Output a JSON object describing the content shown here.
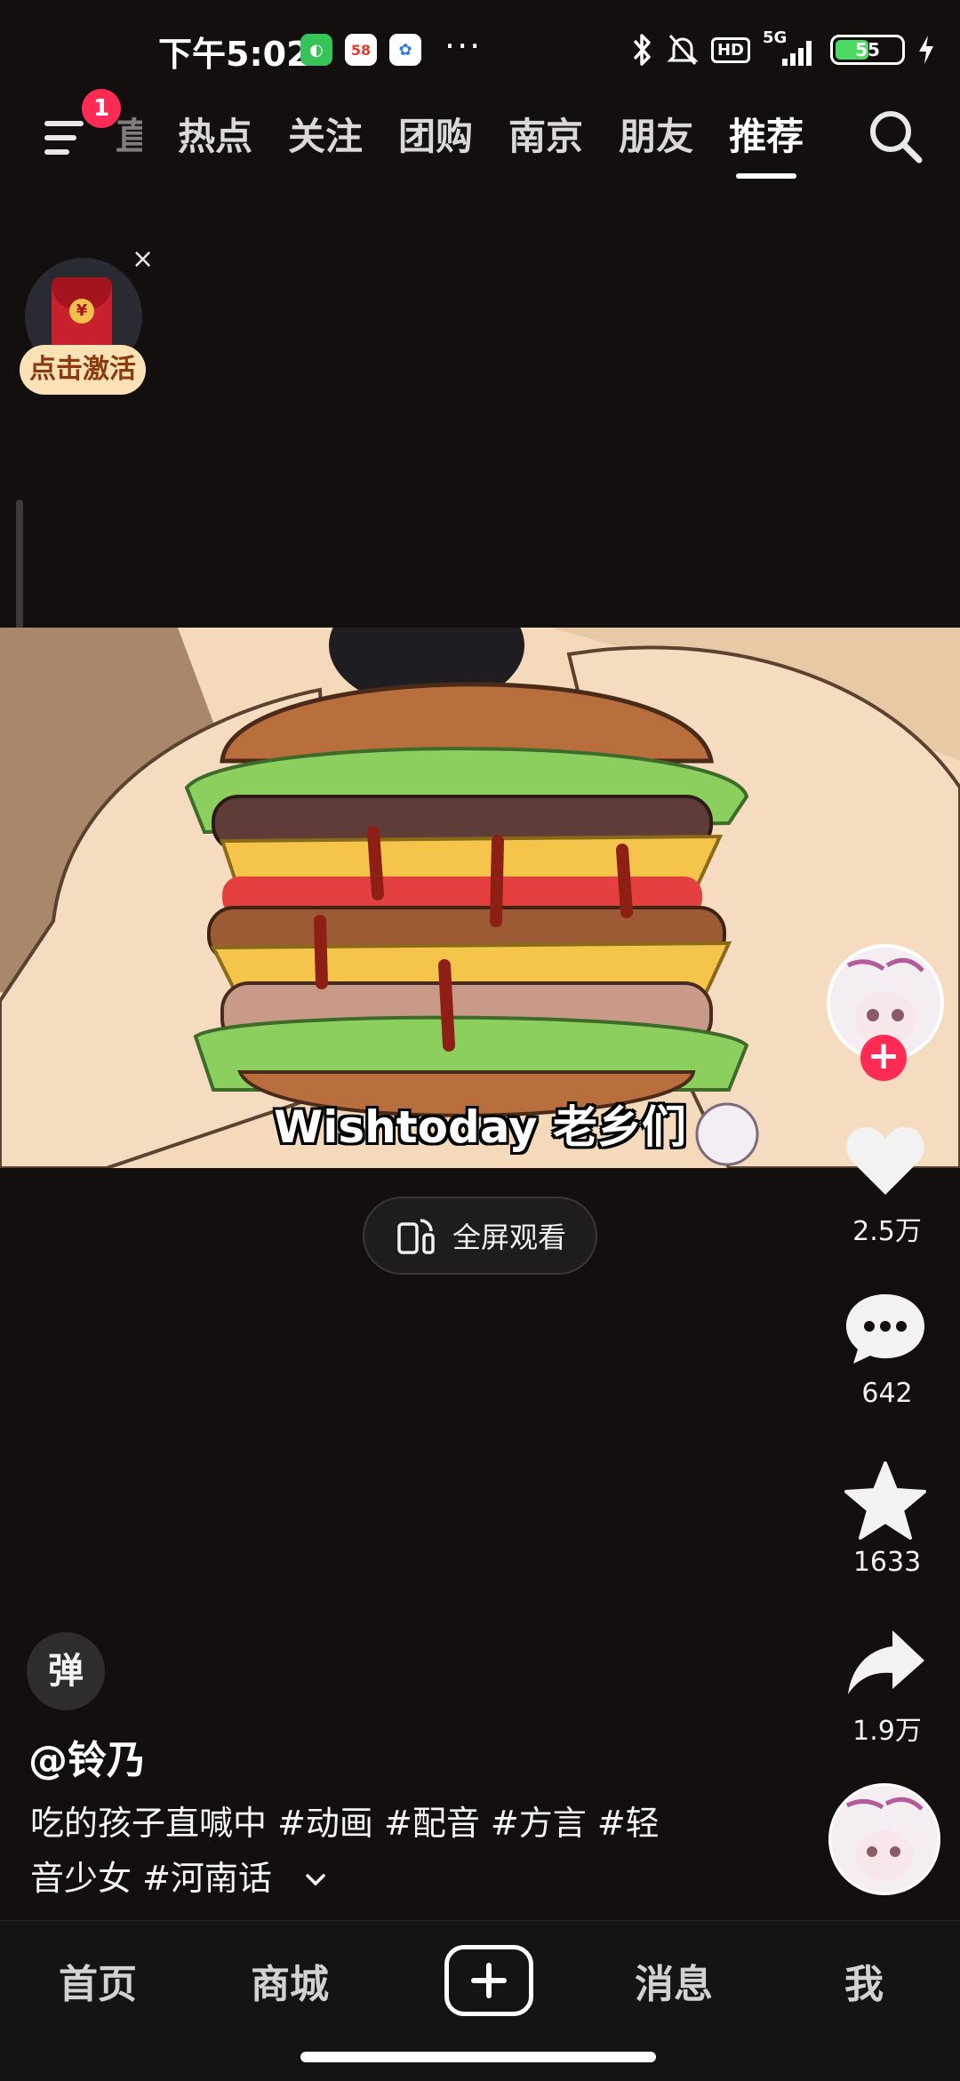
{
  "status_bar": {
    "time": "下午5:02",
    "app_icons": [
      "wechat-icon",
      "58-app-icon",
      "cloud-app-icon"
    ],
    "overflow": "···",
    "network": "5G",
    "hd": "HD",
    "battery": "55",
    "battery_level": 0.55
  },
  "top_nav": {
    "notification_count": "1",
    "tabs": [
      {
        "label": "直播",
        "partial": true
      },
      {
        "label": "热点"
      },
      {
        "label": "关注"
      },
      {
        "label": "团购"
      },
      {
        "label": "南京"
      },
      {
        "label": "朋友"
      },
      {
        "label": "推荐",
        "active": true
      }
    ]
  },
  "red_packet": {
    "label": "点击激活",
    "close": "×",
    "coin": "¥"
  },
  "video": {
    "subtitle": "Wishtoday 老乡们",
    "fullscreen_label": "全屏观看"
  },
  "right_rail": {
    "follow": "+",
    "like_count": "2.5万",
    "comment_count": "642",
    "favorite_count": "1633",
    "share_count": "1.9万"
  },
  "post": {
    "danmu_label": "弹",
    "author": "@铃乃",
    "caption_line1": "吃的孩子直喊中 #动画 #配音  #方言 #轻",
    "caption_line2": "音少女 #河南话"
  },
  "bottom_nav": {
    "home": "首页",
    "mall": "商城",
    "messages": "消息",
    "me": "我"
  },
  "colors": {
    "accent": "#fe2c55",
    "background": "#120f0e",
    "red_packet_label_bg": "#fbe1b6"
  }
}
